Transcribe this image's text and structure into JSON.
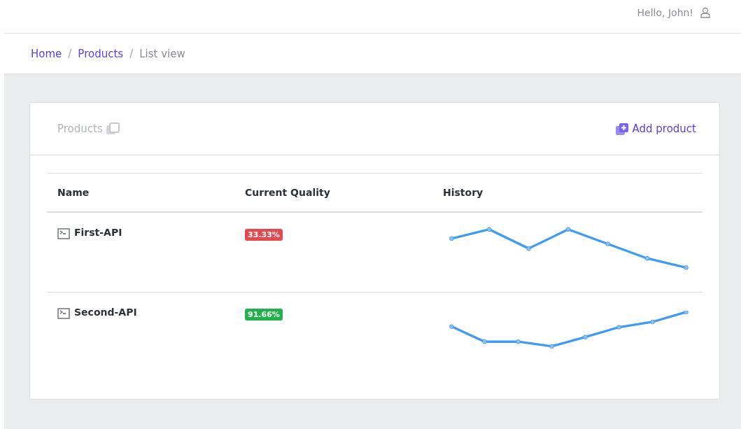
{
  "topbar": {
    "greeting": "Hello, John!"
  },
  "breadcrumb": [
    {
      "label": "Home",
      "kind": "link"
    },
    {
      "label": "/",
      "kind": "separator"
    },
    {
      "label": "Products",
      "kind": "link"
    },
    {
      "label": "/",
      "kind": "separator"
    },
    {
      "label": "List view",
      "kind": "current"
    }
  ],
  "card": {
    "title": "Products",
    "action": "Add product"
  },
  "table": {
    "columns": [
      "Name",
      "Current Quality",
      "History"
    ],
    "rows": [
      {
        "name": "First-API",
        "quality": "33.33%",
        "color": "#e5484d"
      },
      {
        "name": "Second-API",
        "quality": "91.66%",
        "color": "#22b24c"
      }
    ]
  }
}
